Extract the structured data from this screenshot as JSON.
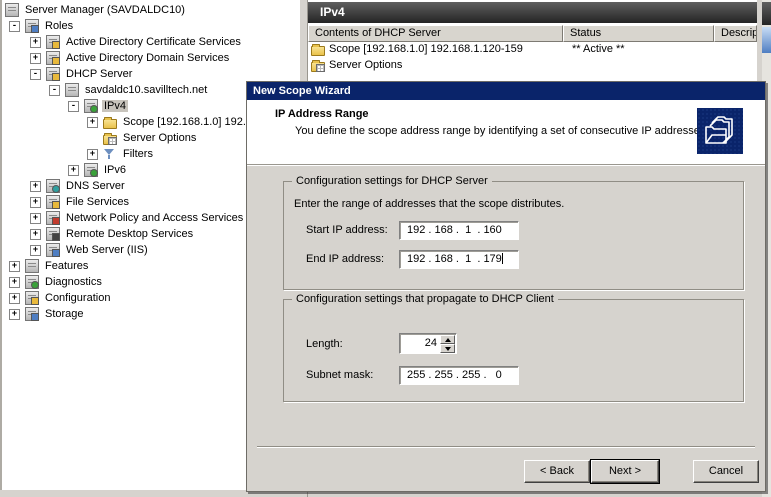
{
  "colors": {
    "titlebar_navy": "#0a246a",
    "pane_header_dark": "#333333",
    "dialog_face": "#d6d3ce",
    "folder_yellow": "#e9c24b",
    "selection_gray": "#c8c4bc"
  },
  "tree": {
    "items": [
      {
        "label": "Server Manager (SAVDALDC10)",
        "level": 0,
        "toggle": "",
        "icon": "server-manager-icon"
      },
      {
        "label": "Roles",
        "level": 1,
        "toggle": "-",
        "icon": "roles-icon"
      },
      {
        "label": "Active Directory Certificate Services",
        "level": 2,
        "toggle": "+",
        "icon": "adcs-icon"
      },
      {
        "label": "Active Directory Domain Services",
        "level": 2,
        "toggle": "+",
        "icon": "adds-icon"
      },
      {
        "label": "DHCP Server",
        "level": 2,
        "toggle": "-",
        "icon": "dhcp-server-icon"
      },
      {
        "label": "savdaldc10.savilltech.net",
        "level": 3,
        "toggle": "-",
        "icon": "server-host-icon"
      },
      {
        "label": "IPv4",
        "level": 4,
        "toggle": "-",
        "icon": "ipv4-icon",
        "selected": true
      },
      {
        "label": "Scope [192.168.1.0] 192.",
        "level": 5,
        "toggle": "+",
        "icon": "scope-folder-icon"
      },
      {
        "label": "Server Options",
        "level": 5,
        "toggle": "",
        "icon": "server-options-icon"
      },
      {
        "label": "Filters",
        "level": 5,
        "toggle": "+",
        "icon": "filters-icon"
      },
      {
        "label": "IPv6",
        "level": 4,
        "toggle": "+",
        "icon": "ipv6-icon"
      },
      {
        "label": "DNS Server",
        "level": 2,
        "toggle": "+",
        "icon": "dns-server-icon"
      },
      {
        "label": "File Services",
        "level": 2,
        "toggle": "+",
        "icon": "file-services-icon"
      },
      {
        "label": "Network Policy and Access Services",
        "level": 2,
        "toggle": "+",
        "icon": "npas-icon"
      },
      {
        "label": "Remote Desktop Services",
        "level": 2,
        "toggle": "+",
        "icon": "rds-icon"
      },
      {
        "label": "Web Server (IIS)",
        "level": 2,
        "toggle": "+",
        "icon": "web-server-icon"
      },
      {
        "label": "Features",
        "level": 1,
        "toggle": "+",
        "icon": "features-icon"
      },
      {
        "label": "Diagnostics",
        "level": 1,
        "toggle": "+",
        "icon": "diagnostics-icon"
      },
      {
        "label": "Configuration",
        "level": 1,
        "toggle": "+",
        "icon": "configuration-icon"
      },
      {
        "label": "Storage",
        "level": 1,
        "toggle": "+",
        "icon": "storage-icon"
      }
    ]
  },
  "list_pane": {
    "title": "IPv4",
    "columns": [
      "Contents of DHCP Server",
      "Status",
      "Descript"
    ],
    "rows": [
      {
        "name": "Scope [192.168.1.0] 192.168.1.120-159",
        "status": "** Active **",
        "icon": "folder-icon"
      },
      {
        "name": "Server Options",
        "status": "",
        "icon": "server-options-icon"
      }
    ]
  },
  "wizard": {
    "title": "New Scope Wizard",
    "heading": "IP Address Range",
    "description": "You define the scope address range by identifying a set of consecutive IP addresses.",
    "header_icon": "folders-stack-icon",
    "group1": {
      "legend": "Configuration settings for DHCP Server",
      "hint": "Enter the range of addresses that the scope distributes.",
      "fields": [
        {
          "label": "Start IP address:",
          "value": "192 . 168 .  1  . 160"
        },
        {
          "label": "End IP address:",
          "value": "192 . 168 .  1  . 179"
        }
      ]
    },
    "group2": {
      "legend": "Configuration settings that propagate to DHCP Client",
      "length_label": "Length:",
      "length_value": "24",
      "subnet_label": "Subnet mask:",
      "subnet_value": "255 . 255 . 255 .   0"
    },
    "buttons": {
      "back": "< Back",
      "next": "Next >",
      "cancel": "Cancel"
    }
  }
}
